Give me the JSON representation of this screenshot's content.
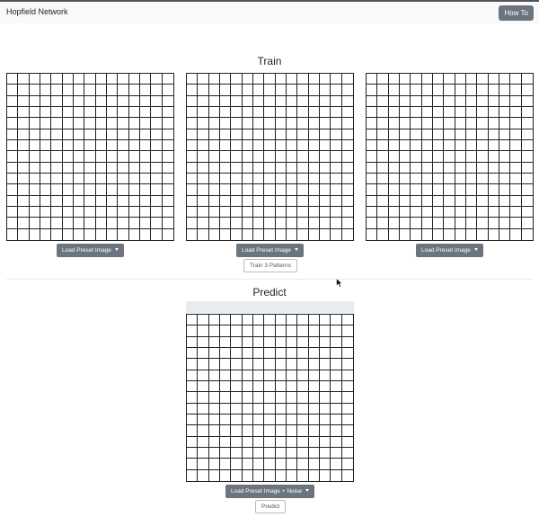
{
  "navbar": {
    "brand": "Hopfield Network",
    "how_to_label": "How To"
  },
  "train": {
    "title": "Train",
    "grid_size": 15,
    "panels": [
      {
        "load_label": "Load Preset Image"
      },
      {
        "load_label": "Load Preset Image"
      },
      {
        "load_label": "Load Preset Image"
      }
    ],
    "train_button_label": "Train 3 Patterns"
  },
  "predict": {
    "title": "Predict",
    "grid_size": 15,
    "load_label": "Load Preset Image + Noise",
    "predict_button_label": "Predict"
  }
}
